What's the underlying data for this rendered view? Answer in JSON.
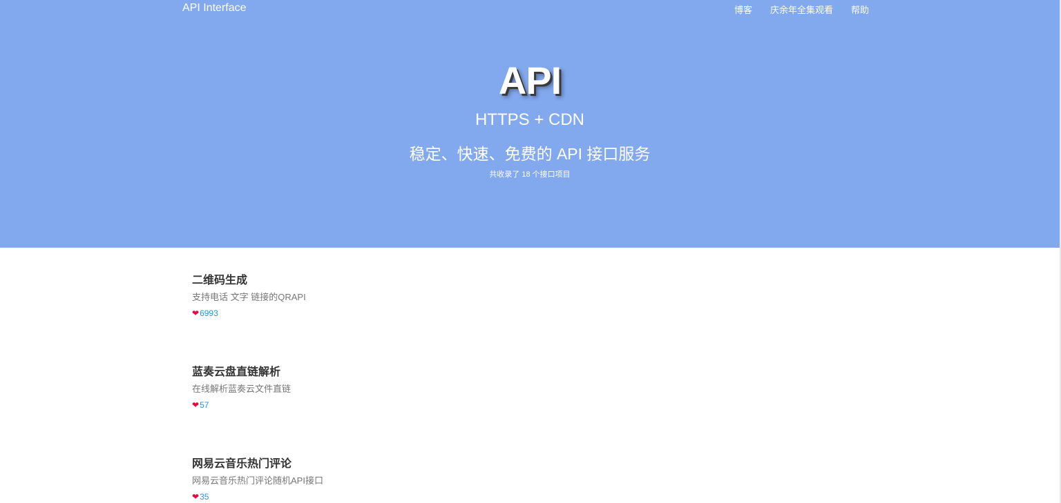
{
  "navbar": {
    "brand": "API Interface",
    "links": [
      {
        "label": "博客"
      },
      {
        "label": "庆余年全集观看"
      },
      {
        "label": "帮助"
      }
    ]
  },
  "hero": {
    "title": "API",
    "subtitle": "HTTPS + CDN",
    "tagline": "稳定、快速、免费的 API 接口服务",
    "count_text": "共收录了 18 个接口项目",
    "background_color": "#82a8ee"
  },
  "apis": [
    {
      "title": "二维码生成",
      "description": "支持电话 文字 链接的QRAPI",
      "likes": "6993"
    },
    {
      "title": "蓝奏云盘直链解析",
      "description": "在线解析蓝奏云文件直链",
      "likes": "57"
    },
    {
      "title": "网易云音乐热门评论",
      "description": "网易云音乐热门评论随机API接口",
      "likes": "35"
    }
  ],
  "colors": {
    "heart": "#e8083e",
    "like_count": "#1a9bd7",
    "title_text": "#333333",
    "desc_text": "#777777"
  },
  "icons": {
    "like": "heart-icon"
  }
}
